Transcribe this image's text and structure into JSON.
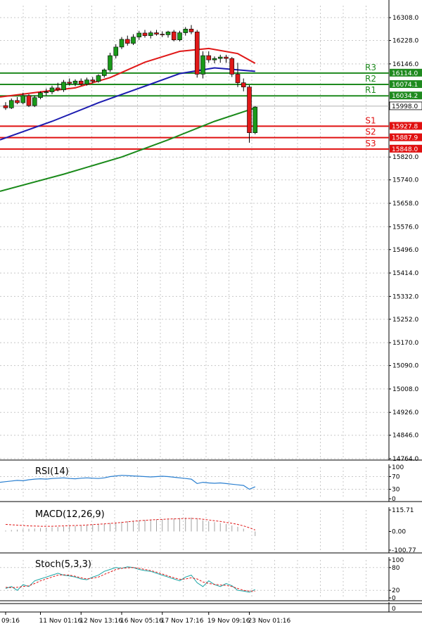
{
  "chart_data": {
    "type": "candlestick",
    "main": {
      "ylim": [
        14764.0,
        16350.0
      ],
      "y_ticks": [
        "16308.0",
        "16228.0",
        "16146.0",
        "15820.0",
        "15740.0",
        "15658.0",
        "15576.0",
        "15496.0",
        "15414.0",
        "15332.0",
        "15252.0",
        "15170.0",
        "15090.0",
        "15008.0",
        "14926.0",
        "14846.0",
        "14764.0"
      ],
      "current_price": "15998.0",
      "levels": [
        {
          "name": "R3",
          "value": 16114.0,
          "label": "16114.0",
          "color": "#1f8a1f"
        },
        {
          "name": "R2",
          "value": 16074.1,
          "label": "16074.1",
          "color": "#1f8a1f"
        },
        {
          "name": "R1",
          "value": 16034.2,
          "label": "16034.2",
          "color": "#1f8a1f"
        },
        {
          "name": "S1",
          "value": 15927.8,
          "label": "15927.8",
          "color": "#e01010"
        },
        {
          "name": "S2",
          "value": 15887.9,
          "label": "15887.9",
          "color": "#e01010"
        },
        {
          "name": "S3",
          "value": 15848.0,
          "label": "15848.0",
          "color": "#e01010"
        }
      ],
      "candles": [
        {
          "o": 16000,
          "h": 16012,
          "l": 15985,
          "c": 15992
        },
        {
          "o": 15992,
          "h": 16025,
          "l": 15988,
          "c": 16018
        },
        {
          "o": 16018,
          "h": 16030,
          "l": 16005,
          "c": 16010
        },
        {
          "o": 16010,
          "h": 16045,
          "l": 16005,
          "c": 16035
        },
        {
          "o": 16035,
          "h": 16040,
          "l": 15995,
          "c": 16000
        },
        {
          "o": 16000,
          "h": 16035,
          "l": 15995,
          "c": 16028
        },
        {
          "o": 16028,
          "h": 16050,
          "l": 16022,
          "c": 16045
        },
        {
          "o": 16045,
          "h": 16060,
          "l": 16035,
          "c": 16048
        },
        {
          "o": 16048,
          "h": 16070,
          "l": 16040,
          "c": 16062
        },
        {
          "o": 16062,
          "h": 16080,
          "l": 16050,
          "c": 16055
        },
        {
          "o": 16055,
          "h": 16090,
          "l": 16048,
          "c": 16082
        },
        {
          "o": 16082,
          "h": 16095,
          "l": 16070,
          "c": 16078
        },
        {
          "o": 16078,
          "h": 16092,
          "l": 16068,
          "c": 16086
        },
        {
          "o": 16086,
          "h": 16095,
          "l": 16070,
          "c": 16075
        },
        {
          "o": 16075,
          "h": 16098,
          "l": 16070,
          "c": 16090
        },
        {
          "o": 16090,
          "h": 16100,
          "l": 16078,
          "c": 16085
        },
        {
          "o": 16085,
          "h": 16110,
          "l": 16080,
          "c": 16105
        },
        {
          "o": 16105,
          "h": 16130,
          "l": 16098,
          "c": 16125
        },
        {
          "o": 16125,
          "h": 16185,
          "l": 16118,
          "c": 16175
        },
        {
          "o": 16175,
          "h": 16215,
          "l": 16165,
          "c": 16205
        },
        {
          "o": 16205,
          "h": 16240,
          "l": 16198,
          "c": 16232
        },
        {
          "o": 16232,
          "h": 16245,
          "l": 16210,
          "c": 16218
        },
        {
          "o": 16218,
          "h": 16250,
          "l": 16212,
          "c": 16240
        },
        {
          "o": 16240,
          "h": 16262,
          "l": 16230,
          "c": 16254
        },
        {
          "o": 16254,
          "h": 16265,
          "l": 16238,
          "c": 16245
        },
        {
          "o": 16245,
          "h": 16262,
          "l": 16235,
          "c": 16255
        },
        {
          "o": 16255,
          "h": 16265,
          "l": 16245,
          "c": 16250
        },
        {
          "o": 16250,
          "h": 16260,
          "l": 16240,
          "c": 16248
        },
        {
          "o": 16248,
          "h": 16262,
          "l": 16238,
          "c": 16258
        },
        {
          "o": 16258,
          "h": 16265,
          "l": 16225,
          "c": 16230
        },
        {
          "o": 16230,
          "h": 16262,
          "l": 16225,
          "c": 16255
        },
        {
          "o": 16255,
          "h": 16275,
          "l": 16245,
          "c": 16268
        },
        {
          "o": 16268,
          "h": 16282,
          "l": 16250,
          "c": 16258
        },
        {
          "o": 16258,
          "h": 16265,
          "l": 16098,
          "c": 16110
        },
        {
          "o": 16110,
          "h": 16190,
          "l": 16095,
          "c": 16175
        },
        {
          "o": 16175,
          "h": 16190,
          "l": 16150,
          "c": 16160
        },
        {
          "o": 16160,
          "h": 16172,
          "l": 16148,
          "c": 16165
        },
        {
          "o": 16165,
          "h": 16178,
          "l": 16150,
          "c": 16170
        },
        {
          "o": 16170,
          "h": 16178,
          "l": 16150,
          "c": 16165
        },
        {
          "o": 16165,
          "h": 16170,
          "l": 16100,
          "c": 16110
        },
        {
          "o": 16110,
          "h": 16150,
          "l": 16065,
          "c": 16080
        },
        {
          "o": 16080,
          "h": 16095,
          "l": 16050,
          "c": 16065
        },
        {
          "o": 16065,
          "h": 16072,
          "l": 15870,
          "c": 15905
        },
        {
          "o": 15905,
          "h": 15998,
          "l": 15900,
          "c": 15995
        }
      ],
      "ma_red": [
        [
          0,
          16030
        ],
        [
          6,
          16048
        ],
        [
          12,
          16062
        ],
        [
          18,
          16098
        ],
        [
          24,
          16152
        ],
        [
          30,
          16190
        ],
        [
          35,
          16200
        ],
        [
          40,
          16182
        ],
        [
          43,
          16148
        ]
      ],
      "ma_blue": [
        [
          0,
          15880
        ],
        [
          8,
          15945
        ],
        [
          16,
          16010
        ],
        [
          24,
          16068
        ],
        [
          30,
          16112
        ],
        [
          36,
          16132
        ],
        [
          43,
          16120
        ]
      ],
      "ma_green": [
        [
          0,
          15700
        ],
        [
          10,
          15760
        ],
        [
          20,
          15820
        ],
        [
          28,
          15880
        ],
        [
          36,
          15945
        ],
        [
          43,
          15992
        ]
      ]
    },
    "rsi": {
      "label": "RSI(14)",
      "ylim": [
        0,
        100
      ],
      "ticks": [
        "100",
        "70",
        "30",
        "0"
      ],
      "values": [
        52,
        54,
        56,
        58,
        57,
        60,
        62,
        63,
        62,
        64,
        65,
        66,
        64,
        63,
        65,
        66,
        65,
        64,
        66,
        70,
        72,
        74,
        73,
        72,
        71,
        70,
        69,
        70,
        71,
        70,
        68,
        66,
        64,
        62,
        48,
        52,
        50,
        49,
        50,
        48,
        46,
        44,
        42,
        30,
        38
      ]
    },
    "macd": {
      "label": "MACD(12,26,9)",
      "ylim": [
        -100.77,
        115.71
      ],
      "ticks": [
        "115.71",
        "0.00",
        "-100.77"
      ],
      "hist": [
        5,
        8,
        10,
        12,
        14,
        16,
        18,
        20,
        22,
        24,
        26,
        28,
        30,
        32,
        35,
        38,
        40,
        42,
        45,
        48,
        52,
        55,
        58,
        60,
        62,
        64,
        65,
        66,
        68,
        70,
        72,
        74,
        75,
        72,
        60,
        55,
        50,
        45,
        40,
        32,
        25,
        15,
        0,
        -25
      ],
      "signal": [
        38,
        36,
        34,
        32,
        30,
        29,
        28,
        28,
        28,
        29,
        30,
        31,
        32,
        33,
        35,
        37,
        39,
        41,
        43,
        46,
        49,
        52,
        55,
        58,
        60,
        62,
        64,
        65,
        67,
        68,
        69,
        70,
        70,
        69,
        66,
        62,
        58,
        54,
        49,
        44,
        38,
        30,
        20,
        8
      ]
    },
    "stoch": {
      "label": "Stoch(5,3,3)",
      "ylim": [
        0,
        100
      ],
      "ticks": [
        "100",
        "80",
        "20",
        "0"
      ],
      "k": [
        25,
        30,
        20,
        35,
        30,
        45,
        50,
        55,
        60,
        65,
        60,
        58,
        55,
        50,
        48,
        55,
        60,
        70,
        75,
        80,
        78,
        82,
        80,
        75,
        72,
        70,
        65,
        60,
        55,
        50,
        45,
        55,
        60,
        40,
        30,
        45,
        35,
        30,
        38,
        32,
        20,
        18,
        15,
        22
      ],
      "d": [
        28,
        27,
        28,
        30,
        32,
        38,
        45,
        50,
        55,
        60,
        61,
        60,
        57,
        53,
        50,
        52,
        55,
        62,
        68,
        75,
        78,
        79,
        80,
        78,
        75,
        72,
        68,
        63,
        58,
        53,
        49,
        50,
        53,
        50,
        42,
        38,
        36,
        34,
        33,
        30,
        25,
        20,
        18,
        18
      ]
    },
    "x_labels": [
      "09:16",
      "11 Nov 01:16",
      "12 Nov 13:16",
      "16 Nov 05:16",
      "17 Nov 17:16",
      "19 Nov 09:16",
      "23 Nov 01:16"
    ],
    "x_label_candle_index": [
      0,
      6,
      13,
      20,
      27,
      35,
      42
    ]
  }
}
